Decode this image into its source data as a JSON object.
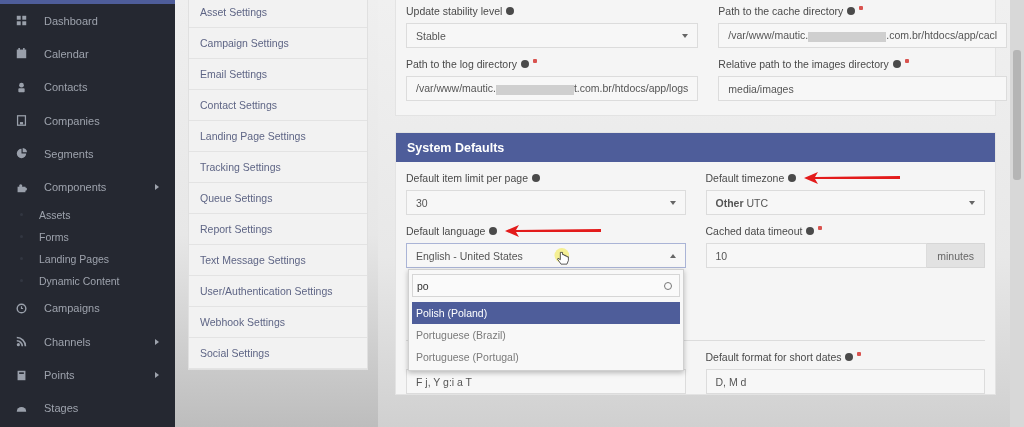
{
  "sidebar": {
    "items": [
      {
        "label": "Dashboard",
        "has_arrow": false
      },
      {
        "label": "Calendar",
        "has_arrow": false
      },
      {
        "label": "Contacts",
        "has_arrow": false
      },
      {
        "label": "Companies",
        "has_arrow": false
      },
      {
        "label": "Segments",
        "has_arrow": false
      },
      {
        "label": "Components",
        "has_arrow": true,
        "children": [
          {
            "label": "Assets"
          },
          {
            "label": "Forms"
          },
          {
            "label": "Landing Pages"
          },
          {
            "label": "Dynamic Content"
          }
        ]
      },
      {
        "label": "Campaigns",
        "has_arrow": false
      },
      {
        "label": "Channels",
        "has_arrow": true
      },
      {
        "label": "Points",
        "has_arrow": true
      },
      {
        "label": "Stages",
        "has_arrow": false
      }
    ]
  },
  "settings_nav": {
    "items": [
      {
        "label": "Asset Settings"
      },
      {
        "label": "Campaign Settings"
      },
      {
        "label": "Email Settings"
      },
      {
        "label": "Contact Settings"
      },
      {
        "label": "Landing Page Settings"
      },
      {
        "label": "Tracking Settings"
      },
      {
        "label": "Queue Settings"
      },
      {
        "label": "Report Settings"
      },
      {
        "label": "Text Message Settings"
      },
      {
        "label": "User/Authentication Settings"
      },
      {
        "label": "Webhook Settings"
      },
      {
        "label": "Social Settings"
      }
    ]
  },
  "sections": [
    {
      "fields": [
        {
          "kind": "select",
          "label": "Update stability level",
          "required": false,
          "value": "Stable"
        },
        {
          "kind": "redacted",
          "label": "Path to the cache directory",
          "required": true,
          "value_before": "/var/www/mautic.",
          "value_after": ".com.br/htdocs/app/cacl"
        },
        {
          "kind": "redacted",
          "label": "Path to the log directory",
          "required": true,
          "value_before": "/var/www/mautic.",
          "value_after": "t.com.br/htdocs/app/logs"
        },
        {
          "kind": "text",
          "label": "Relative path to the images directory",
          "required": true,
          "value": "media/images"
        }
      ]
    },
    {
      "title": "System Defaults",
      "fields": [
        {
          "kind": "select",
          "label": "Default item limit per page",
          "required": false,
          "value": "30"
        },
        {
          "kind": "select",
          "label": "Default timezone",
          "required": false,
          "arrow": true,
          "value_group": "Other",
          "value": "UTC"
        },
        {
          "kind": "open-select",
          "label": "Default language",
          "required": false,
          "arrow": true,
          "value": "English - United States",
          "search": "po",
          "options": [
            {
              "label": "Polish (Poland)",
              "selected": true
            },
            {
              "label": "Portuguese (Brazil)",
              "selected": false
            },
            {
              "label": "Portuguese (Portugal)",
              "selected": false
            }
          ]
        },
        {
          "kind": "addon",
          "label": "Cached data timeout",
          "required": true,
          "value": "10",
          "addon": "minutes"
        }
      ],
      "more_fields": [
        {
          "kind": "text",
          "value": "F j, Y g:i a T"
        },
        {
          "kind": "text",
          "label": "Default format for short dates",
          "required": true,
          "value": "D, M d"
        }
      ]
    }
  ]
}
